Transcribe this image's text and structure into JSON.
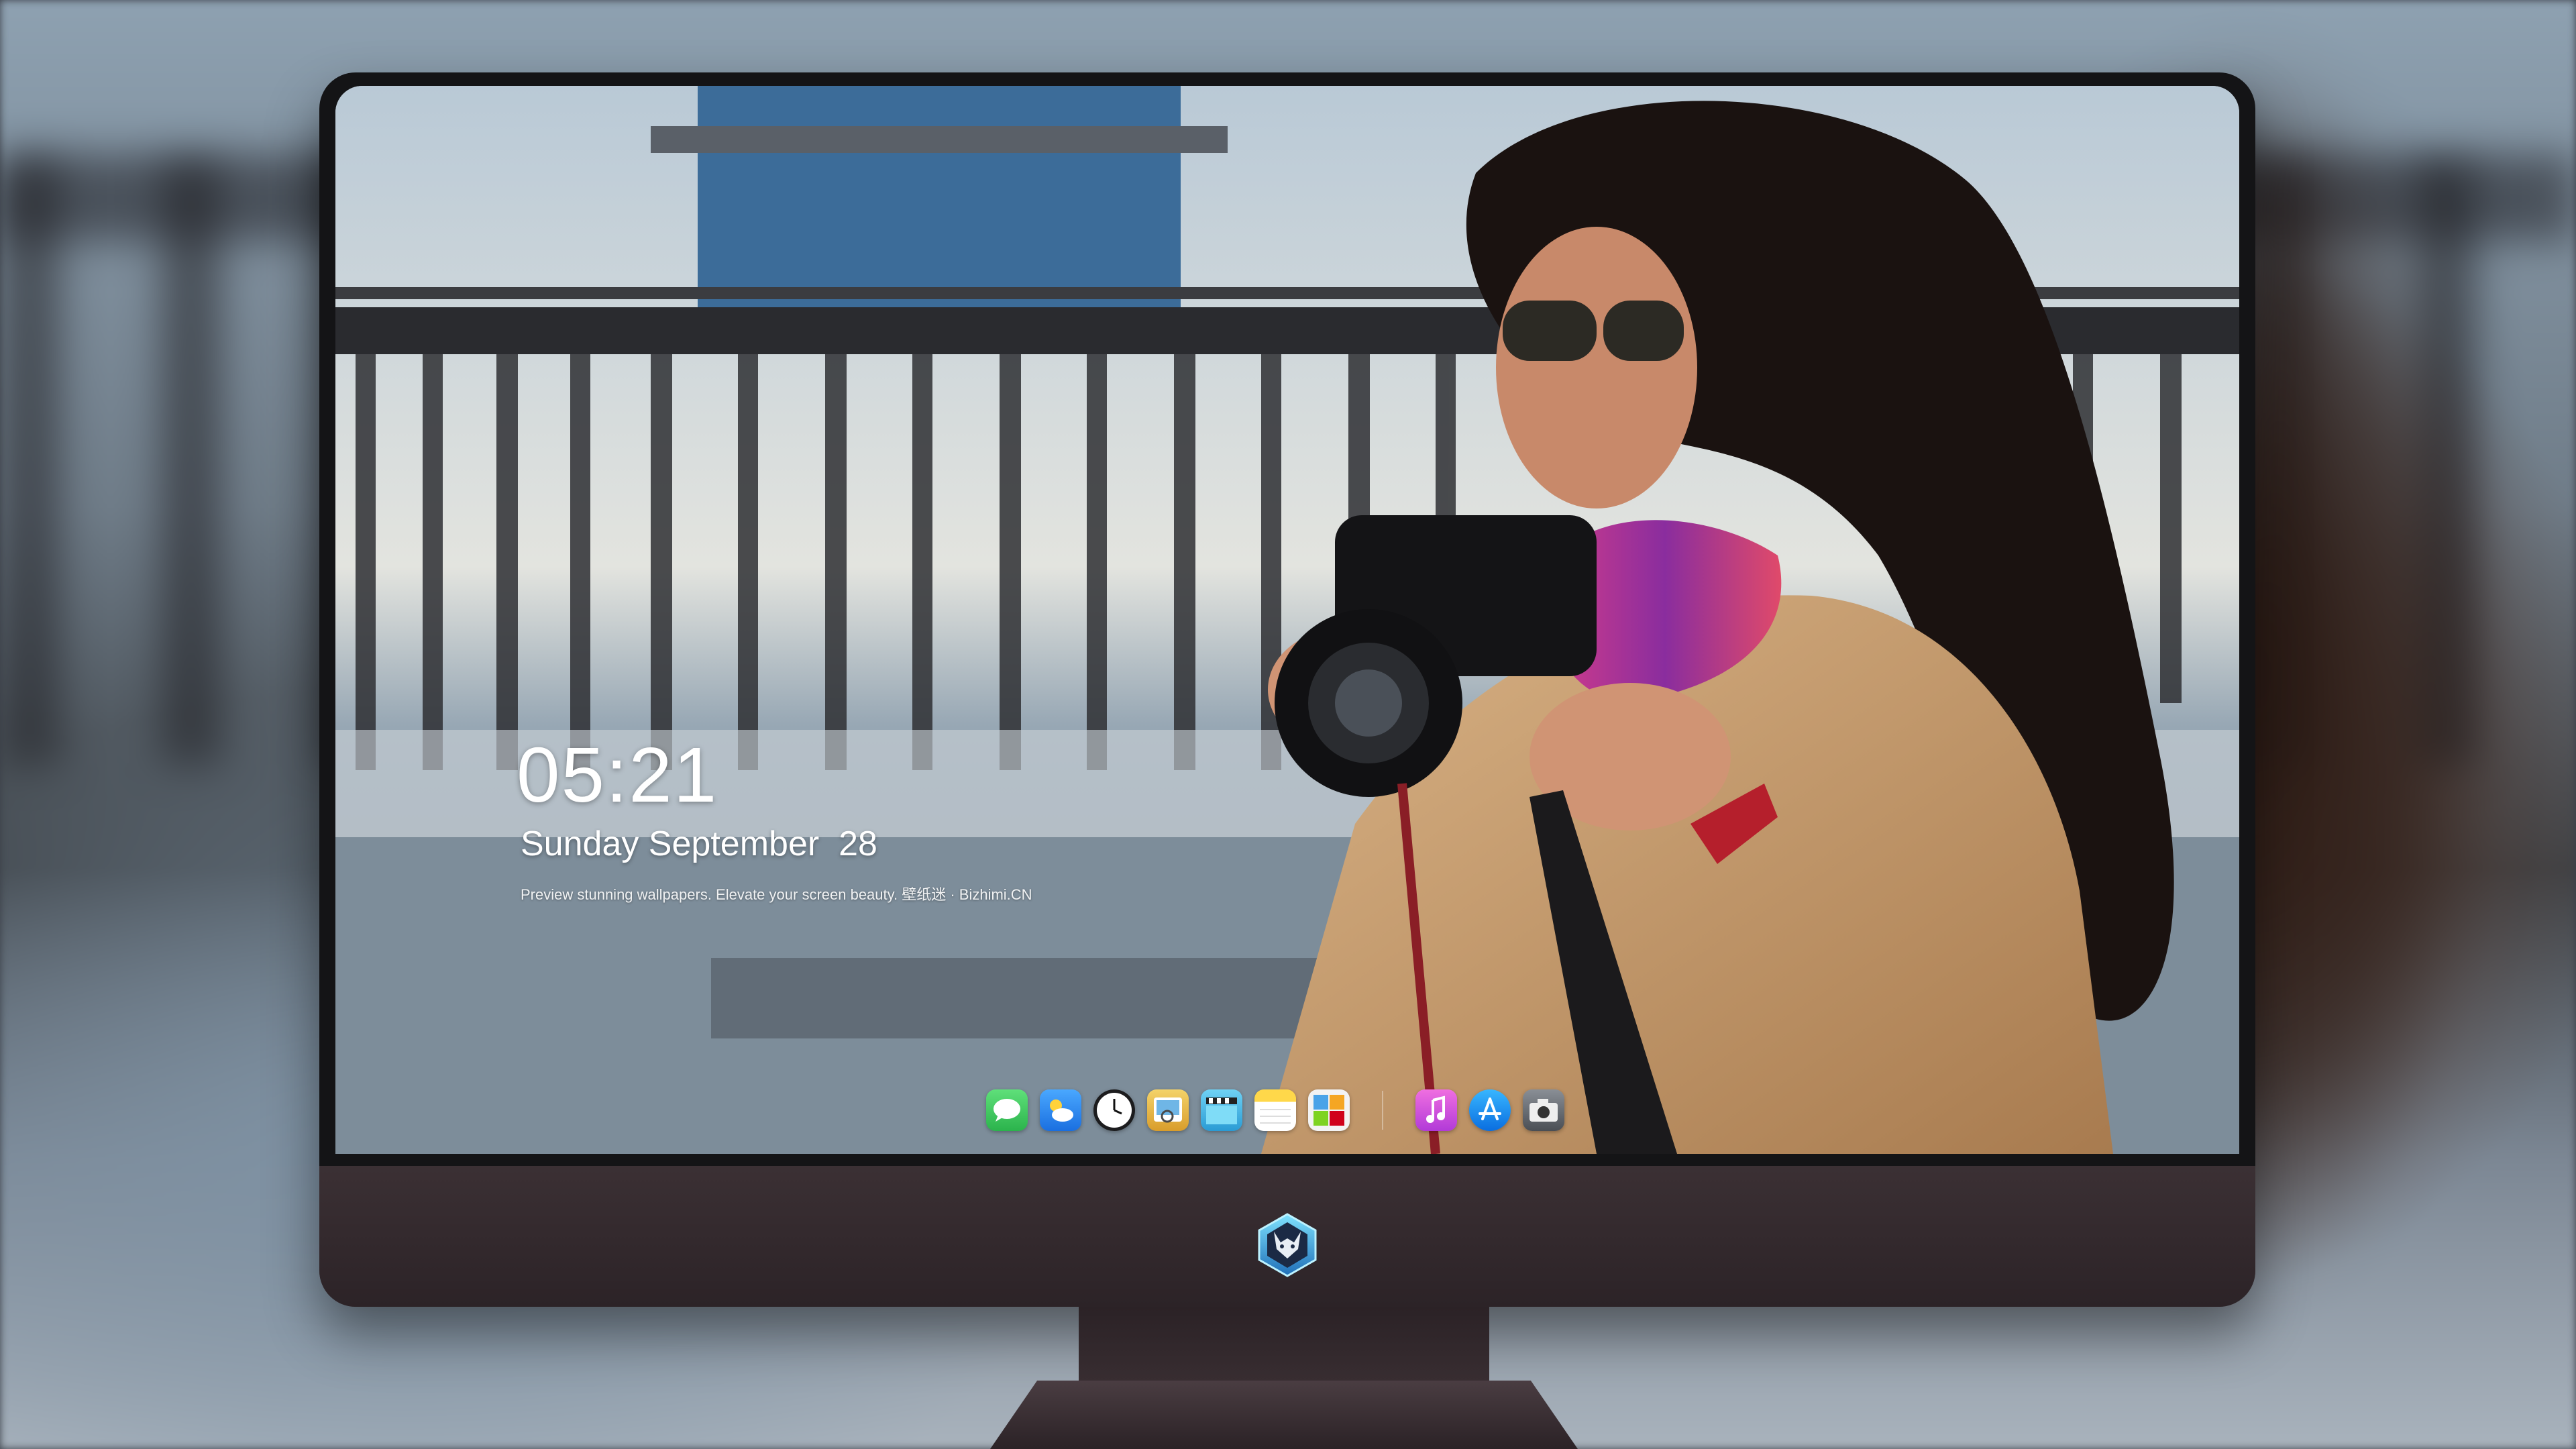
{
  "lockscreen": {
    "time": "05:21",
    "date": "Sunday September  28",
    "tagline": "Preview stunning wallpapers. Elevate your screen beauty. 壁纸迷 · Bizhimi.CN"
  },
  "dock": {
    "apps": [
      {
        "name": "messages-icon",
        "color": "#35c759"
      },
      {
        "name": "weather-icon",
        "color": "#2f8ef5"
      },
      {
        "name": "clock-icon",
        "color": "#1c1c1e"
      },
      {
        "name": "preview-icon",
        "color": "#e9b949"
      },
      {
        "name": "clips-icon",
        "color": "#49b6e8"
      },
      {
        "name": "notes-icon",
        "color": "#f5d34a"
      },
      {
        "name": "photo-booth-icon",
        "color": "#8ac926"
      }
    ],
    "apps_right": [
      {
        "name": "music-icon",
        "color": "#d94fd9"
      },
      {
        "name": "app-store-icon",
        "color": "#1c8cf0"
      },
      {
        "name": "camera-icon",
        "color": "#6b6f75"
      }
    ]
  },
  "wallpaper": {
    "subject": "woman-with-camera",
    "colors": {
      "sky": "#c8d4df",
      "pier": "#2e2f33",
      "coat": "#c49a6a",
      "scarf": "#c5307a",
      "hair": "#1a1210"
    }
  }
}
